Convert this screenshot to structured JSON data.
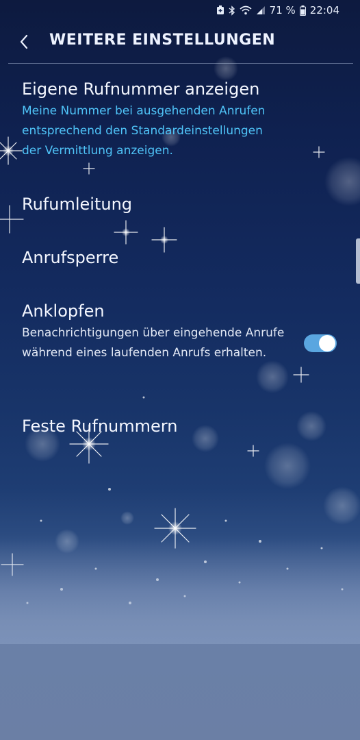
{
  "status_bar": {
    "battery_percent": "71 %",
    "time": "22:04",
    "icons": [
      "battery-saver-icon",
      "bluetooth-icon",
      "wifi-icon",
      "signal-icon",
      "battery-icon"
    ]
  },
  "header": {
    "title": "WEITERE EINSTELLUNGEN",
    "back_icon": "chevron-left-icon"
  },
  "settings": [
    {
      "title": "Eigene Rufnummer anzeigen",
      "subtitle_lines": [
        "Meine Nummer bei ausgehenden Anrufen",
        "entsprechend den Standardeinstellungen",
        "der Vermittlung anzeigen."
      ]
    },
    {
      "title": "Rufumleitung"
    },
    {
      "title": "Anrufsperre"
    },
    {
      "title": "Anklopfen",
      "subtitle": "Benachrichtigungen über eingehende Anrufe während eines laufenden Anrufs erhalten.",
      "toggle_on": true
    },
    {
      "title": "Feste Rufnummern"
    }
  ],
  "colors": {
    "accent": "#4fc3f7",
    "toggle_track": "#5aa6e0"
  }
}
